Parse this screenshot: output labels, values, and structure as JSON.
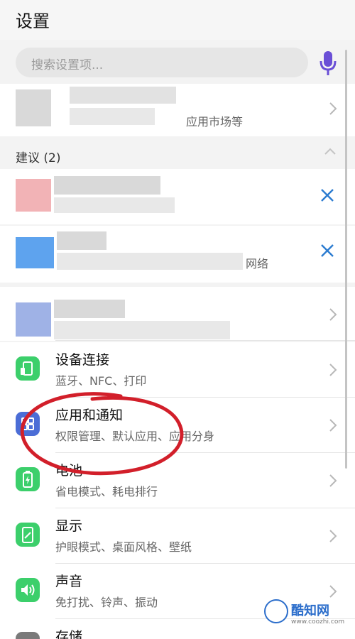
{
  "header": {
    "title": "设置"
  },
  "search": {
    "placeholder": "搜索设置项..."
  },
  "top_card": {
    "subtitle": "应用市场等"
  },
  "suggestions": {
    "label": "建议 (2)",
    "items": [
      {
        "text": ""
      },
      {
        "text": "网络"
      }
    ]
  },
  "settings": [
    {
      "title": "设备连接",
      "subtitle": "蓝牙、NFC、打印",
      "icon": "device-connection-icon",
      "color": "#2ecc71"
    },
    {
      "title": "应用和通知",
      "subtitle": "权限管理、默认应用、应用分身",
      "icon": "apps-grid-icon",
      "color": "#4b6dd6"
    },
    {
      "title": "电池",
      "subtitle": "省电模式、耗电排行",
      "icon": "battery-icon",
      "color": "#2ecc71"
    },
    {
      "title": "显示",
      "subtitle": "护眼模式、桌面风格、壁纸",
      "icon": "display-icon",
      "color": "#2ecc71"
    },
    {
      "title": "声音",
      "subtitle": "免打扰、铃声、振动",
      "icon": "sound-icon",
      "color": "#2ecc71"
    },
    {
      "title": "存储",
      "subtitle": "",
      "icon": "storage-icon",
      "color": "#7a7a7a"
    }
  ],
  "watermark": {
    "name": "酷知网",
    "url": "www.coozhi.com"
  }
}
